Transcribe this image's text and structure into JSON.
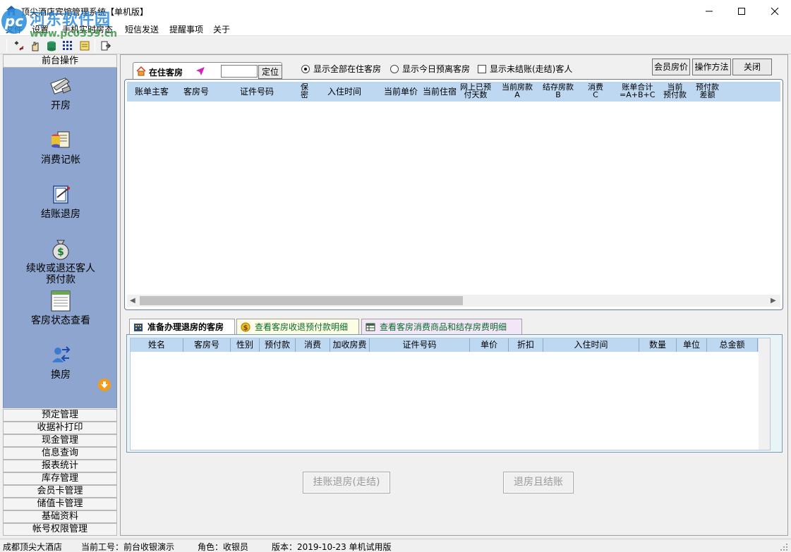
{
  "window": {
    "title": "顶尖酒店宾馆管理系统【单机版】"
  },
  "watermark": {
    "logo": "pc",
    "title": "河东软件园",
    "url": "www.pc0359.cn"
  },
  "menu": [
    "文件",
    "设置",
    "手机实时房态",
    "短信发送",
    "提醒事项",
    "关于"
  ],
  "sidebar": {
    "header": "前台操作",
    "tools": [
      {
        "label": "开房",
        "icon": "open-room-icon"
      },
      {
        "label": "消费记帐",
        "icon": "consumption-icon"
      },
      {
        "label": "结账退房",
        "icon": "checkout-icon"
      },
      {
        "label": "续收或退还客人\n预付款",
        "icon": "money-bag-icon"
      },
      {
        "label": "客房状态查看",
        "icon": "room-status-icon"
      },
      {
        "label": "换房",
        "icon": "change-room-icon"
      }
    ],
    "categories": [
      "预定管理",
      "收据补打印",
      "现金管理",
      "信息查询",
      "报表统计",
      "库存管理",
      "会员卡管理",
      "储值卡管理",
      "基础资料",
      "帐号权限管理"
    ]
  },
  "top": {
    "tab_label": "在住客房",
    "search_value": "",
    "locate": "定位",
    "radio_all": "显示全部在住客房",
    "radio_today": "显示今日预离客房",
    "check_unsettled": "显示未结账(走结)客人",
    "btn_member_price": "会员房价",
    "btn_howto": "操作方法",
    "btn_close": "关闭"
  },
  "upper_columns": {
    "c1": "账单主客",
    "c2": "客房号",
    "c3": "证件号码",
    "c4a": "保",
    "c4b": "密",
    "c5": "入住时间",
    "c6": "当前单价",
    "c7": "当前住宿",
    "c8a": "网上已预",
    "c8b": "付天数",
    "c9a": "当前房款",
    "c9b": "A",
    "c10a": "结存房款",
    "c10b": "B",
    "c11a": "消费",
    "c11b": "C",
    "c12a": "账单合计",
    "c12b": "=A+B+C",
    "c13a": "当前",
    "c13b": "预付款",
    "c14a": "预付款",
    "c14b": "差额"
  },
  "lower_tabs": [
    "准备办理退房的客房",
    "查看客房收退预付款明细",
    "查看客房消费商品和结存房费明细"
  ],
  "lower_columns": [
    "姓名",
    "客房号",
    "性别",
    "预付款",
    "消费",
    "加收房费",
    "证件号码",
    "单价",
    "折扣",
    "入住时间",
    "数量",
    "单位",
    "总金额"
  ],
  "actions": {
    "charge_checkout": "挂账退房(走结)",
    "checkout_settle": "退房且结账"
  },
  "status": {
    "hotel": "成都顶尖大酒店",
    "operator": "当前工号：前台收银演示",
    "role": "角色：收银员",
    "version": "版本：2019-10-23 单机试用版"
  }
}
